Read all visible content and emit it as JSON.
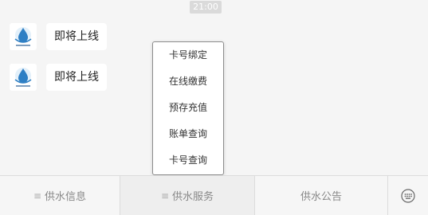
{
  "chat": {
    "timestamp": "21:00",
    "messages": [
      {
        "text": "即将上线"
      },
      {
        "text": "即将上线"
      }
    ]
  },
  "popup_menu": {
    "items": [
      "卡号绑定",
      "在线缴费",
      "预存充值",
      "账单查询",
      "卡号查询"
    ]
  },
  "bottom_menu": {
    "tabs": [
      {
        "label": "供水信息",
        "icon": "menu-lines-icon"
      },
      {
        "label": "供水服务",
        "icon": "menu-lines-icon"
      },
      {
        "label": "供水公告"
      }
    ],
    "keyboard_icon": "keyboard-icon"
  },
  "colors": {
    "background": "#f5f5f5",
    "bubble": "#ffffff",
    "logo_blue": "#2e7fc4"
  }
}
